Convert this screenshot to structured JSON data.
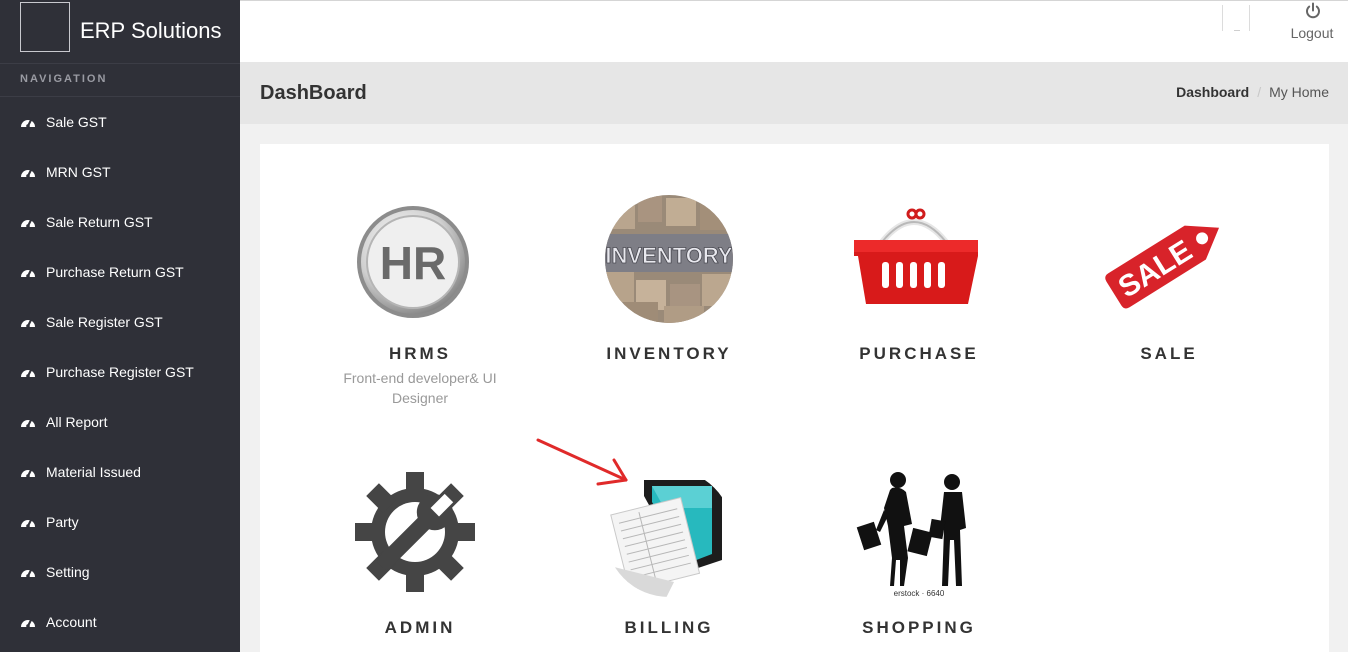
{
  "brand": {
    "title": "ERP Solutions"
  },
  "nav": {
    "heading": "NAVIGATION",
    "items": [
      {
        "label": "Sale GST",
        "icon": "dashboard-icon"
      },
      {
        "label": "MRN GST",
        "icon": "dashboard-icon"
      },
      {
        "label": "Sale Return GST",
        "icon": "dashboard-icon"
      },
      {
        "label": "Purchase Return GST",
        "icon": "dashboard-icon"
      },
      {
        "label": "Sale Register GST",
        "icon": "dashboard-icon"
      },
      {
        "label": "Purchase Register GST",
        "icon": "dashboard-icon"
      },
      {
        "label": "All Report",
        "icon": "dashboard-icon"
      },
      {
        "label": "Material Issued",
        "icon": "dashboard-icon"
      },
      {
        "label": "Party",
        "icon": "dashboard-icon"
      },
      {
        "label": "Setting",
        "icon": "dashboard-icon"
      },
      {
        "label": "Account",
        "icon": "dashboard-icon"
      }
    ]
  },
  "header": {
    "logout_label": "Logout",
    "logout_icon": "power-icon"
  },
  "page": {
    "title": "DashBoard",
    "breadcrumb": {
      "active": "Dashboard",
      "home": "My Home"
    }
  },
  "tiles": {
    "hrms": {
      "label": "HRMS",
      "subtitle": "Front-end developer& UI Designer",
      "icon": "hr-badge-icon",
      "badge_text": "HR"
    },
    "inventory": {
      "label": "INVENTORY",
      "icon": "inventory-boxes-icon",
      "badge_text": "INVENTORY"
    },
    "purchase": {
      "label": "PURCHASE",
      "icon": "shopping-basket-icon"
    },
    "sale": {
      "label": "SALE",
      "icon": "sale-tag-icon",
      "badge_text": "SALE"
    },
    "admin": {
      "label": "ADMIN",
      "icon": "gear-wrench-icon"
    },
    "billing": {
      "label": "BILLING",
      "icon": "invoice-laptop-icon"
    },
    "shopping": {
      "label": "SHOPPING",
      "icon": "shoppers-silhouette-icon",
      "watermark": "erstock · 6640"
    }
  },
  "colors": {
    "sidebar": "#2f3038",
    "sale_red": "#d8232a",
    "annotation_arrow": "#e02a2a"
  }
}
